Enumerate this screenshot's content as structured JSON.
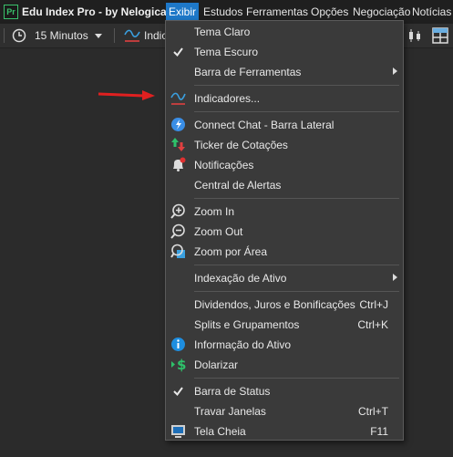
{
  "titlebar": {
    "logo_text": "Pr",
    "app_title": "Edu Index Pro - by Nelogica",
    "menus": [
      "Exibir",
      "Estudos",
      "Ferramentas",
      "Opções",
      "Negociação",
      "Notícias"
    ]
  },
  "toolbar": {
    "timeframe": "15 Minutos",
    "indicators_partial": "Indic"
  },
  "dropdown": {
    "items": [
      {
        "label": "Tema Claro"
      },
      {
        "label": "Tema Escuro",
        "checked": true
      },
      {
        "label": "Barra de Ferramentas",
        "submenu": true
      },
      {
        "label": "Indicadores...",
        "icon": "indicators-icon"
      },
      {
        "label": "Connect Chat - Barra Lateral",
        "icon": "chat-icon"
      },
      {
        "label": "Ticker de Cotações",
        "icon": "ticker-icon"
      },
      {
        "label": "Notificações",
        "icon": "bell-icon"
      },
      {
        "label": "Central de Alertas"
      },
      {
        "label": "Zoom In",
        "icon": "zoom-in-icon"
      },
      {
        "label": "Zoom Out",
        "icon": "zoom-out-icon"
      },
      {
        "label": "Zoom por Área",
        "icon": "zoom-area-icon"
      },
      {
        "label": "Indexação de Ativo",
        "submenu": true
      },
      {
        "label": "Dividendos, Juros e Bonificações",
        "shortcut": "Ctrl+J"
      },
      {
        "label": "Splits e Grupamentos",
        "shortcut": "Ctrl+K"
      },
      {
        "label": "Informação do Ativo",
        "icon": "info-icon"
      },
      {
        "label": "Dolarizar",
        "icon": "dollar-icon"
      },
      {
        "label": "Barra de Status",
        "checked": true
      },
      {
        "label": "Travar Janelas",
        "shortcut": "Ctrl+T"
      },
      {
        "label": "Tela Cheia",
        "shortcut": "F11",
        "icon": "fullscreen-icon"
      }
    ]
  },
  "colors": {
    "menu_active": "#1e78c8",
    "annotation_arrow": "#e02020"
  }
}
